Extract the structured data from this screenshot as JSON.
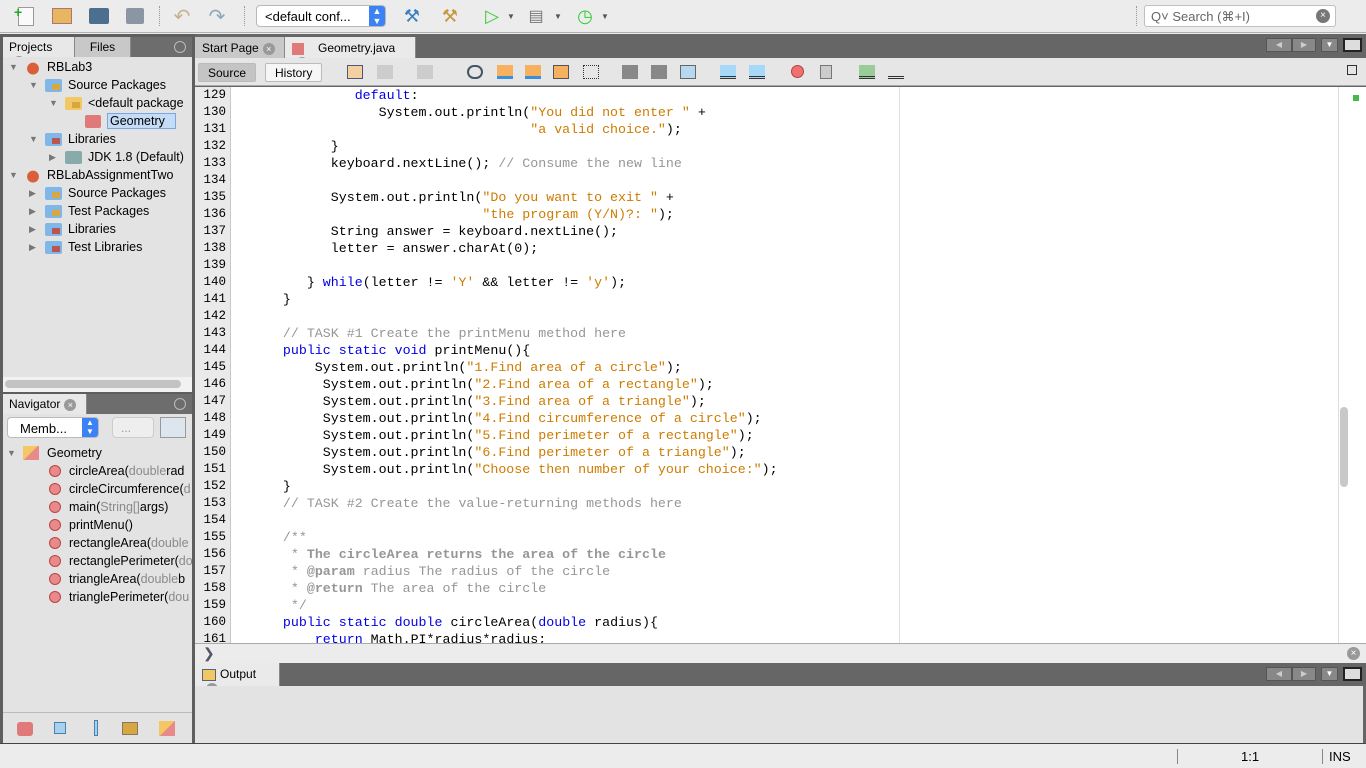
{
  "toolbar": {
    "icons": [
      "new-file-icon",
      "new-project-icon",
      "open-project-icon",
      "save-all-icon",
      "undo-icon",
      "redo-icon"
    ],
    "config_select": "<default conf...",
    "search_placeholder": "Q˅ Search (⌘+I)"
  },
  "projects_panel": {
    "tabs": [
      "Projects",
      "Files"
    ],
    "tree": [
      {
        "label": "RBLab3",
        "level": 0,
        "expanded": true,
        "icon": "project"
      },
      {
        "label": "Source Packages",
        "level": 1,
        "expanded": true,
        "icon": "folder"
      },
      {
        "label": "<default package",
        "level": 2,
        "expanded": true,
        "icon": "package"
      },
      {
        "label": "Geometry",
        "level": 3,
        "selected": true,
        "icon": "java-class"
      },
      {
        "label": "Libraries",
        "level": 1,
        "expanded": true,
        "icon": "library"
      },
      {
        "label": "JDK 1.8 (Default)",
        "level": 2,
        "expanded": false,
        "icon": "jdk"
      },
      {
        "label": "RBLabAssignmentTwo",
        "level": 0,
        "expanded": true,
        "icon": "project"
      },
      {
        "label": "Source Packages",
        "level": 1,
        "expanded": false,
        "icon": "folder"
      },
      {
        "label": "Test Packages",
        "level": 1,
        "expanded": false,
        "icon": "folder"
      },
      {
        "label": "Libraries",
        "level": 1,
        "expanded": false,
        "icon": "library"
      },
      {
        "label": "Test Libraries",
        "level": 1,
        "expanded": false,
        "icon": "library"
      }
    ]
  },
  "navigator": {
    "title": "Navigator",
    "filter_select": "Memb...",
    "second_select": "...",
    "class_name": "Geometry",
    "members": [
      [
        "circleArea(",
        "double",
        " rad"
      ],
      [
        "circleCircumference(",
        "d",
        ""
      ],
      [
        "main(",
        "String[]",
        " args)"
      ],
      [
        "printMenu()",
        "",
        ""
      ],
      [
        "rectangleArea(",
        "double",
        ""
      ],
      [
        "rectanglePerimeter(",
        "do",
        ""
      ],
      [
        "triangleArea(",
        "double",
        " b"
      ],
      [
        "trianglePerimeter(",
        "dou",
        ""
      ]
    ]
  },
  "editor": {
    "tabs": [
      {
        "label": "Start Page",
        "active": false
      },
      {
        "label": "Geometry.java",
        "active": true
      }
    ],
    "source_label": "Source",
    "history_label": "History",
    "first_line": 129,
    "lines": [
      [
        [
          "t",
          "               "
        ],
        [
          "k",
          "default"
        ],
        [
          "t",
          ":"
        ]
      ],
      [
        [
          "t",
          "                  System.out.println("
        ],
        [
          "s",
          "\"You did not enter \""
        ],
        [
          "t",
          " +"
        ]
      ],
      [
        [
          "t",
          "                                     "
        ],
        [
          "s",
          "\"a valid choice.\""
        ],
        [
          "t",
          ");"
        ]
      ],
      [
        [
          "t",
          "            }"
        ]
      ],
      [
        [
          "t",
          "            keyboard.nextLine(); "
        ],
        [
          "c",
          "// Consume the new line"
        ]
      ],
      [],
      [
        [
          "t",
          "            System.out.println("
        ],
        [
          "s",
          "\"Do you want to exit \""
        ],
        [
          "t",
          " +"
        ]
      ],
      [
        [
          "t",
          "                               "
        ],
        [
          "s",
          "\"the program (Y/N)?: \""
        ],
        [
          "t",
          ");"
        ]
      ],
      [
        [
          "t",
          "            String answer = keyboard.nextLine();"
        ]
      ],
      [
        [
          "t",
          "            letter = answer.charAt(0);"
        ]
      ],
      [],
      [
        [
          "t",
          "         } "
        ],
        [
          "k",
          "while"
        ],
        [
          "t",
          "(letter != "
        ],
        [
          "s",
          "'Y'"
        ],
        [
          "t",
          " && letter != "
        ],
        [
          "s",
          "'y'"
        ],
        [
          "t",
          ");"
        ]
      ],
      [
        [
          "t",
          "      }"
        ]
      ],
      [],
      [
        [
          "t",
          "      "
        ],
        [
          "c",
          "// TASK #1 Create the printMenu method here"
        ]
      ],
      [
        [
          "t",
          "      "
        ],
        [
          "k",
          "public static void"
        ],
        [
          "t",
          " printMenu(){"
        ]
      ],
      [
        [
          "t",
          "          System.out.println("
        ],
        [
          "s",
          "\"1.Find area of a circle\""
        ],
        [
          "t",
          ");"
        ]
      ],
      [
        [
          "t",
          "           System.out.println("
        ],
        [
          "s",
          "\"2.Find area of a rectangle\""
        ],
        [
          "t",
          ");"
        ]
      ],
      [
        [
          "t",
          "           System.out.println("
        ],
        [
          "s",
          "\"3.Find area of a triangle\""
        ],
        [
          "t",
          ");"
        ]
      ],
      [
        [
          "t",
          "           System.out.println("
        ],
        [
          "s",
          "\"4.Find circumference of a circle\""
        ],
        [
          "t",
          ");"
        ]
      ],
      [
        [
          "t",
          "           System.out.println("
        ],
        [
          "s",
          "\"5.Find perimeter of a rectangle\""
        ],
        [
          "t",
          ");"
        ]
      ],
      [
        [
          "t",
          "           System.out.println("
        ],
        [
          "s",
          "\"6.Find perimeter of a triangle\""
        ],
        [
          "t",
          ");"
        ]
      ],
      [
        [
          "t",
          "           System.out.println("
        ],
        [
          "s",
          "\"Choose then number of your choice:\""
        ],
        [
          "t",
          ");"
        ]
      ],
      [
        [
          "t",
          "      }"
        ]
      ],
      [
        [
          "t",
          "      "
        ],
        [
          "c",
          "// TASK #2 Create the value-returning methods here"
        ]
      ],
      [],
      [
        [
          "t",
          "      "
        ],
        [
          "c",
          "/**"
        ]
      ],
      [
        [
          "t",
          "      "
        ],
        [
          "c",
          " * "
        ],
        [
          "cb",
          "The circleArea returns the area of the circle"
        ]
      ],
      [
        [
          "t",
          "      "
        ],
        [
          "c",
          " * "
        ],
        [
          "cb",
          "@param"
        ],
        [
          "c",
          " radius The radius of the circle"
        ]
      ],
      [
        [
          "t",
          "      "
        ],
        [
          "c",
          " * "
        ],
        [
          "cb",
          "@return"
        ],
        [
          "c",
          " The area of the circle"
        ]
      ],
      [
        [
          "t",
          "      "
        ],
        [
          "c",
          " */"
        ]
      ],
      [
        [
          "t",
          "      "
        ],
        [
          "k",
          "public static double"
        ],
        [
          "t",
          " circleArea("
        ],
        [
          "k",
          "double"
        ],
        [
          "t",
          " radius){"
        ]
      ],
      [
        [
          "t",
          "          "
        ],
        [
          "k",
          "return"
        ],
        [
          "t",
          " Math.PI*radius*radius;"
        ]
      ]
    ]
  },
  "output": {
    "tab_label": "Output"
  },
  "status": {
    "position": "1:1",
    "mode": "INS"
  },
  "colors": {
    "keyword": "#0000e6",
    "string": "#ce7b00",
    "comment": "#969696",
    "selection": "#c5dcf7"
  }
}
